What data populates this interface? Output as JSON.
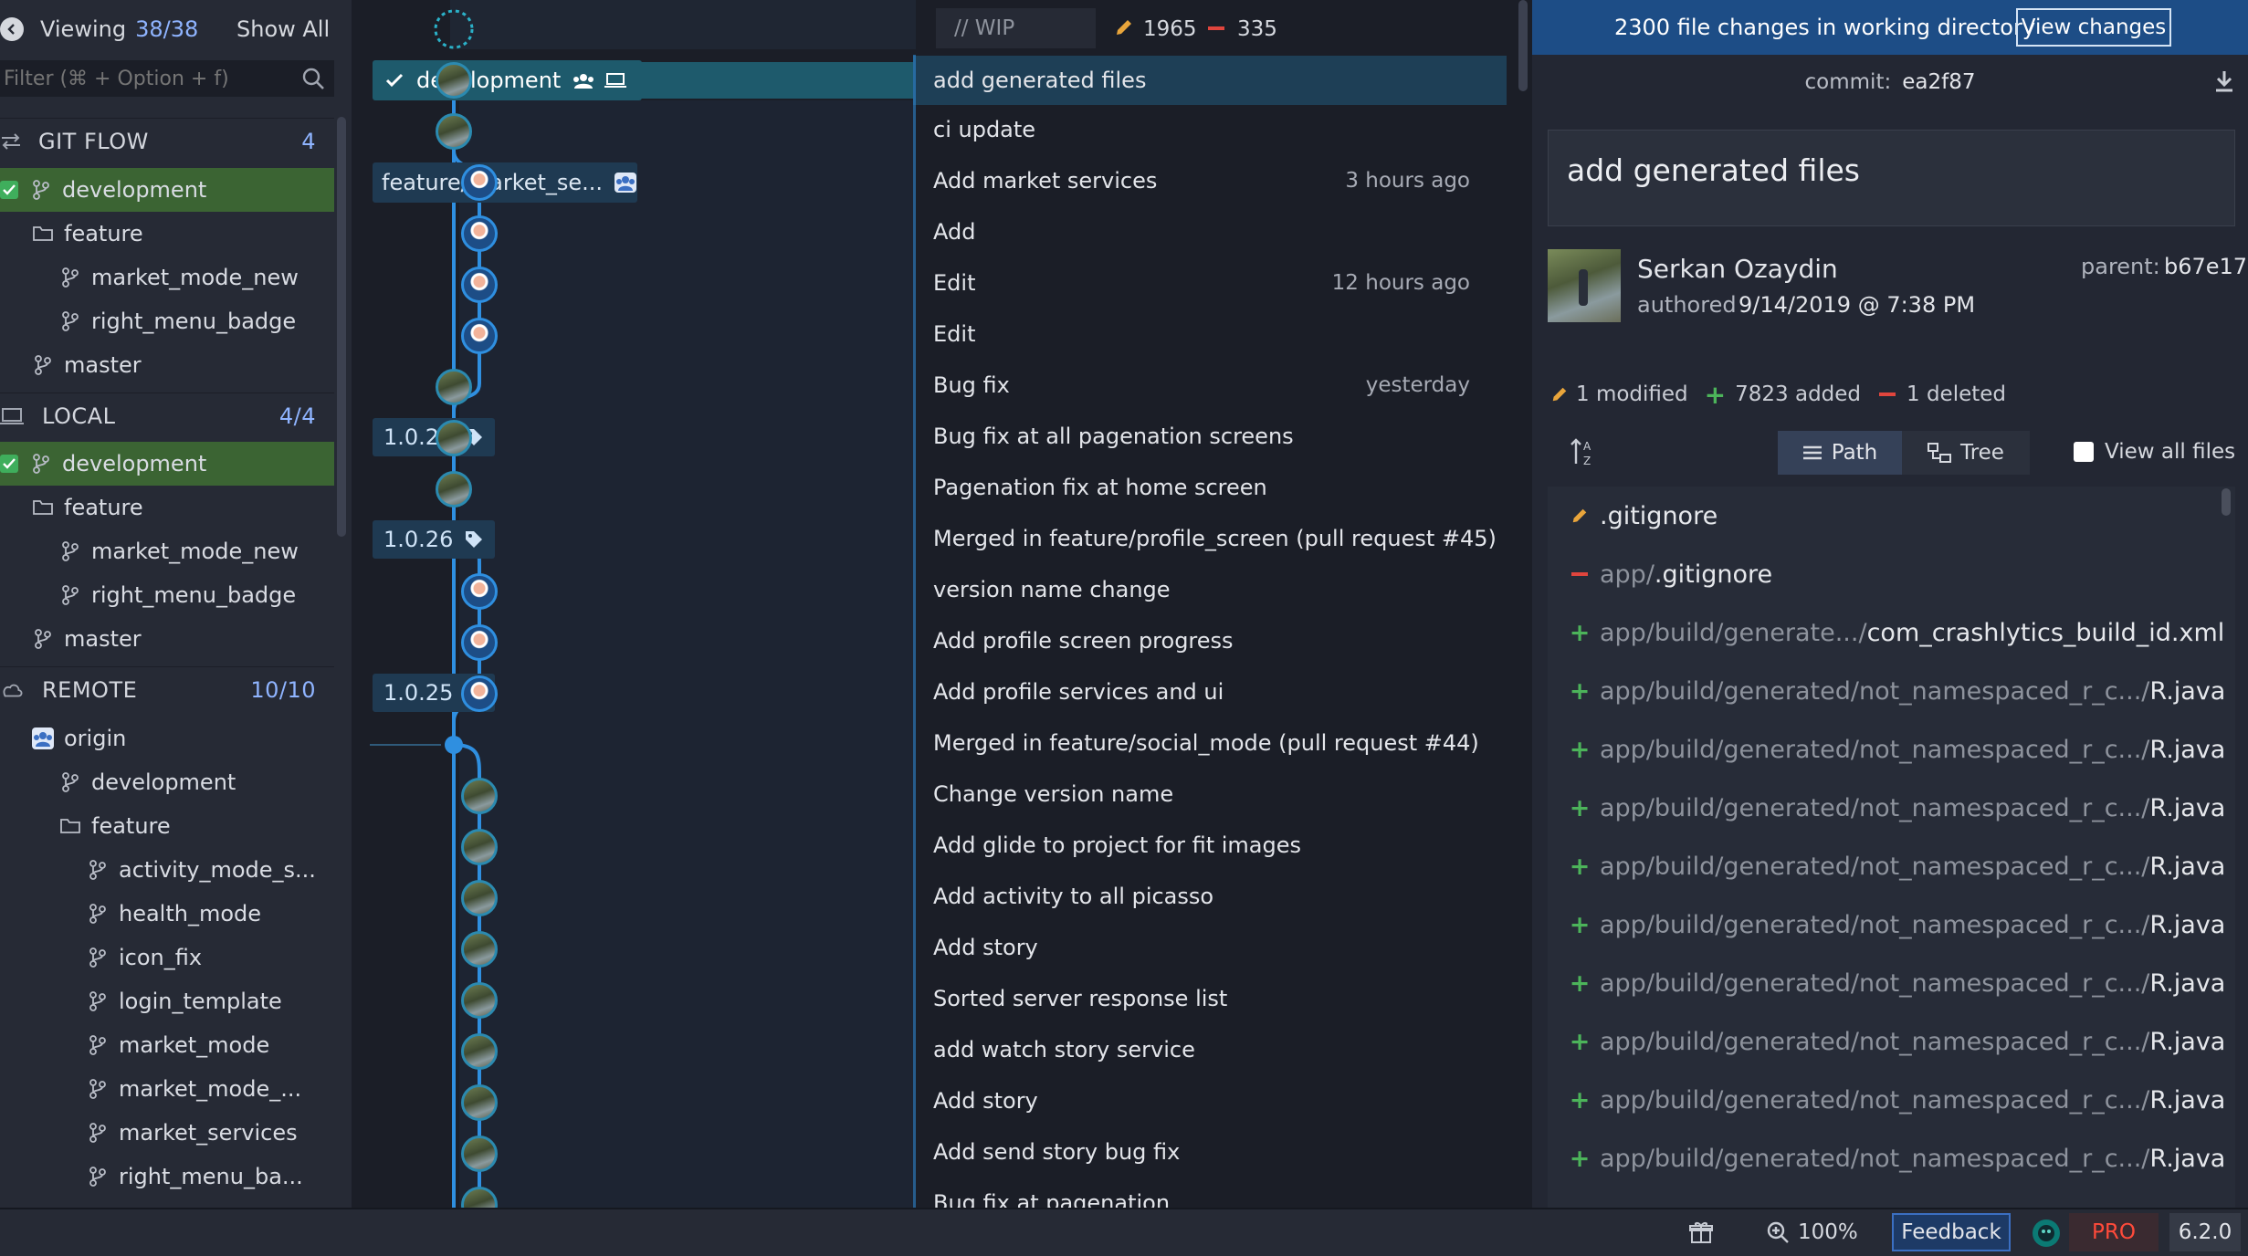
{
  "left_panel": {
    "viewing_label": "Viewing",
    "viewing_count": "38/38",
    "show_all": "Show All",
    "filter_placeholder": "Filter (⌘ + Option + f)",
    "gitflow": {
      "label": "GIT FLOW",
      "count": "4",
      "items": [
        "development",
        "feature",
        "market_mode_new",
        "right_menu_badge",
        "master"
      ]
    },
    "local": {
      "label": "LOCAL",
      "count": "4/4",
      "items": [
        "development",
        "feature",
        "market_mode_new",
        "right_menu_badge",
        "master"
      ]
    },
    "remote": {
      "label": "REMOTE",
      "count": "10/10",
      "origin": "origin",
      "items": [
        "development",
        "feature",
        "activity_mode_s...",
        "health_mode",
        "icon_fix",
        "login_template",
        "market_mode",
        "market_mode_...",
        "market_services",
        "right_menu_ba..."
      ]
    }
  },
  "graph": {
    "wip_label": "// WIP",
    "wip_modified": "1965",
    "wip_deleted": "335",
    "branch_labels": {
      "development": "development",
      "feature": "feature/market_se..."
    },
    "tags": [
      "1.0.27",
      "1.0.26",
      "1.0.25"
    ],
    "commits": [
      {
        "message": "add generated files",
        "time": ""
      },
      {
        "message": "ci update",
        "time": ""
      },
      {
        "message": "Add market services",
        "time": "3 hours ago"
      },
      {
        "message": "Add",
        "time": ""
      },
      {
        "message": "Edit",
        "time": "12 hours ago"
      },
      {
        "message": "Edit",
        "time": ""
      },
      {
        "message": "Bug fix",
        "time": "yesterday"
      },
      {
        "message": "Bug fix at all pagenation screens",
        "time": ""
      },
      {
        "message": "Pagenation fix at home screen",
        "time": ""
      },
      {
        "message": "Merged in feature/profile_screen (pull request #45)",
        "time": ""
      },
      {
        "message": "version name change",
        "time": ""
      },
      {
        "message": "Add profile screen progress",
        "time": ""
      },
      {
        "message": "Add profile services and ui",
        "time": ""
      },
      {
        "message": "Merged in feature/social_mode (pull request #44)",
        "time": ""
      },
      {
        "message": "Change version name",
        "time": ""
      },
      {
        "message": "Add glide to project for fit images",
        "time": ""
      },
      {
        "message": "Add activity to all picasso",
        "time": ""
      },
      {
        "message": "Add story",
        "time": ""
      },
      {
        "message": "Sorted server response list",
        "time": ""
      },
      {
        "message": "add watch story service",
        "time": ""
      },
      {
        "message": "Add story",
        "time": ""
      },
      {
        "message": "Add send story bug fix",
        "time": ""
      },
      {
        "message": "Bug fix at pagenation",
        "time": ""
      }
    ]
  },
  "right_panel": {
    "banner_text": "2300 file changes in working directory",
    "view_changes": "View changes",
    "commit_label": "commit:",
    "commit_sha": "ea2f87",
    "summary": "add generated files",
    "author": "Serkan Ozaydin",
    "authored_label": "authored",
    "authored_date": "9/14/2019 @ 7:38 PM",
    "parent_label": "parent:",
    "parent_sha": "b67e17",
    "stats": {
      "modified": "1 modified",
      "added": "7823 added",
      "deleted": "1 deleted"
    },
    "path_label": "Path",
    "tree_label": "Tree",
    "view_all_files": "View all files",
    "files": [
      {
        "status": "modified",
        "dir": "",
        "name": ".gitignore"
      },
      {
        "status": "deleted",
        "dir": "app/",
        "name": ".gitignore"
      },
      {
        "status": "added",
        "dir": "app/build/generate.../",
        "name": "com_crashlytics_build_id.xml"
      },
      {
        "status": "added",
        "dir": "app/build/generated/not_namespaced_r_c.../",
        "name": "R.java"
      },
      {
        "status": "added",
        "dir": "app/build/generated/not_namespaced_r_c.../",
        "name": "R.java"
      },
      {
        "status": "added",
        "dir": "app/build/generated/not_namespaced_r_c.../",
        "name": "R.java"
      },
      {
        "status": "added",
        "dir": "app/build/generated/not_namespaced_r_c.../",
        "name": "R.java"
      },
      {
        "status": "added",
        "dir": "app/build/generated/not_namespaced_r_c.../",
        "name": "R.java"
      },
      {
        "status": "added",
        "dir": "app/build/generated/not_namespaced_r_c.../",
        "name": "R.java"
      },
      {
        "status": "added",
        "dir": "app/build/generated/not_namespaced_r_c.../",
        "name": "R.java"
      },
      {
        "status": "added",
        "dir": "app/build/generated/not_namespaced_r_c.../",
        "name": "R.java"
      },
      {
        "status": "added",
        "dir": "app/build/generated/not_namespaced_r_c.../",
        "name": "R.java"
      }
    ]
  },
  "status_bar": {
    "zoom": "100%",
    "feedback": "Feedback",
    "pro": "PRO",
    "version": "6.2.0"
  },
  "colors": {
    "accent": "#1d4d86",
    "graph_line": "#2f8fe0",
    "selected_branch": "#3b6433",
    "added": "#4cb45a",
    "deleted": "#e0453d",
    "modified": "#e9a53b"
  },
  "icons": [
    "back-icon",
    "search-icon",
    "gitflow-icon",
    "branch-icon",
    "folder-icon",
    "laptop-icon",
    "cloud-icon",
    "remote-avatar-icon",
    "check-icon",
    "tag-icon",
    "pencil-icon",
    "minus-icon",
    "plus-icon",
    "download-icon",
    "sort-az-icon",
    "list-icon",
    "tree-icon",
    "gift-icon",
    "zoom-icon",
    "gitkraken-icon"
  ]
}
